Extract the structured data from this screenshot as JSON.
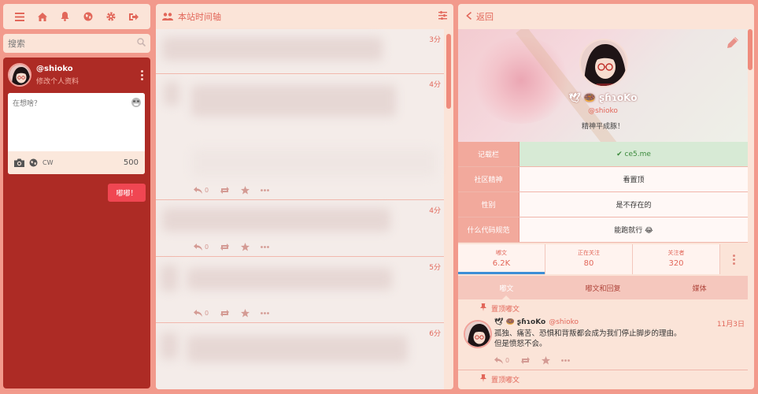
{
  "nav": {
    "icons": [
      "menu-icon",
      "home-icon",
      "bell-icon",
      "globe-icon",
      "gear-icon",
      "logout-icon"
    ]
  },
  "search": {
    "placeholder": "搜索"
  },
  "account": {
    "handle": "@shioko",
    "edit_label": "修改个人资料"
  },
  "compose": {
    "placeholder": "在想啥？",
    "cw_label": "CW",
    "char_count": "500",
    "submit_label": "嘟嘟！"
  },
  "timeline": {
    "title": "本站时间轴",
    "items": [
      {
        "time": "3分"
      },
      {
        "time": "4分",
        "reply_count": "0"
      },
      {
        "time": "4分",
        "reply_count": "0"
      },
      {
        "time": "5分",
        "reply_count": "0"
      },
      {
        "time": "6分"
      }
    ]
  },
  "profile": {
    "back_label": "返回",
    "display_name": "🕊 🍩 ʂɦɿoKo",
    "handle": "@shioko",
    "bio": "精神平成豚！",
    "fields": [
      {
        "name": "记载栏",
        "value": "✔ ce5.me",
        "verified": true
      },
      {
        "name": "社区精神",
        "value": "看置顶",
        "verified": false
      },
      {
        "name": "性别",
        "value": "是不存在的",
        "verified": false
      },
      {
        "name": "什么代码规范",
        "value": "能跑就行 😂",
        "verified": false
      }
    ],
    "stats": [
      {
        "label": "嘟文",
        "value": "6.2K"
      },
      {
        "label": "正在关注",
        "value": "80"
      },
      {
        "label": "关注者",
        "value": "320"
      }
    ],
    "tabs": [
      "嘟文",
      "嘟文和回复",
      "媒体"
    ],
    "pinned_label": "置顶嘟文",
    "pinned_post": {
      "name": "🕊 🍩 ʂɦɿoKo",
      "acct": "@shioko",
      "date": "11月3日",
      "body_line1": "孤独、痛苦、恐惧和背叛都会成为我们停止脚步的理由。",
      "body_line2": "但是愤怒不会。",
      "reply_count": "0"
    },
    "pinned_label_2": "置顶嘟文"
  },
  "colors": {
    "background": "#f29a8c",
    "panel": "#fbe4d8",
    "compose_panel": "#ad2b25",
    "accent": "#e2675a",
    "submit": "#f04652",
    "active_tab_underline": "#3c8fd6"
  }
}
